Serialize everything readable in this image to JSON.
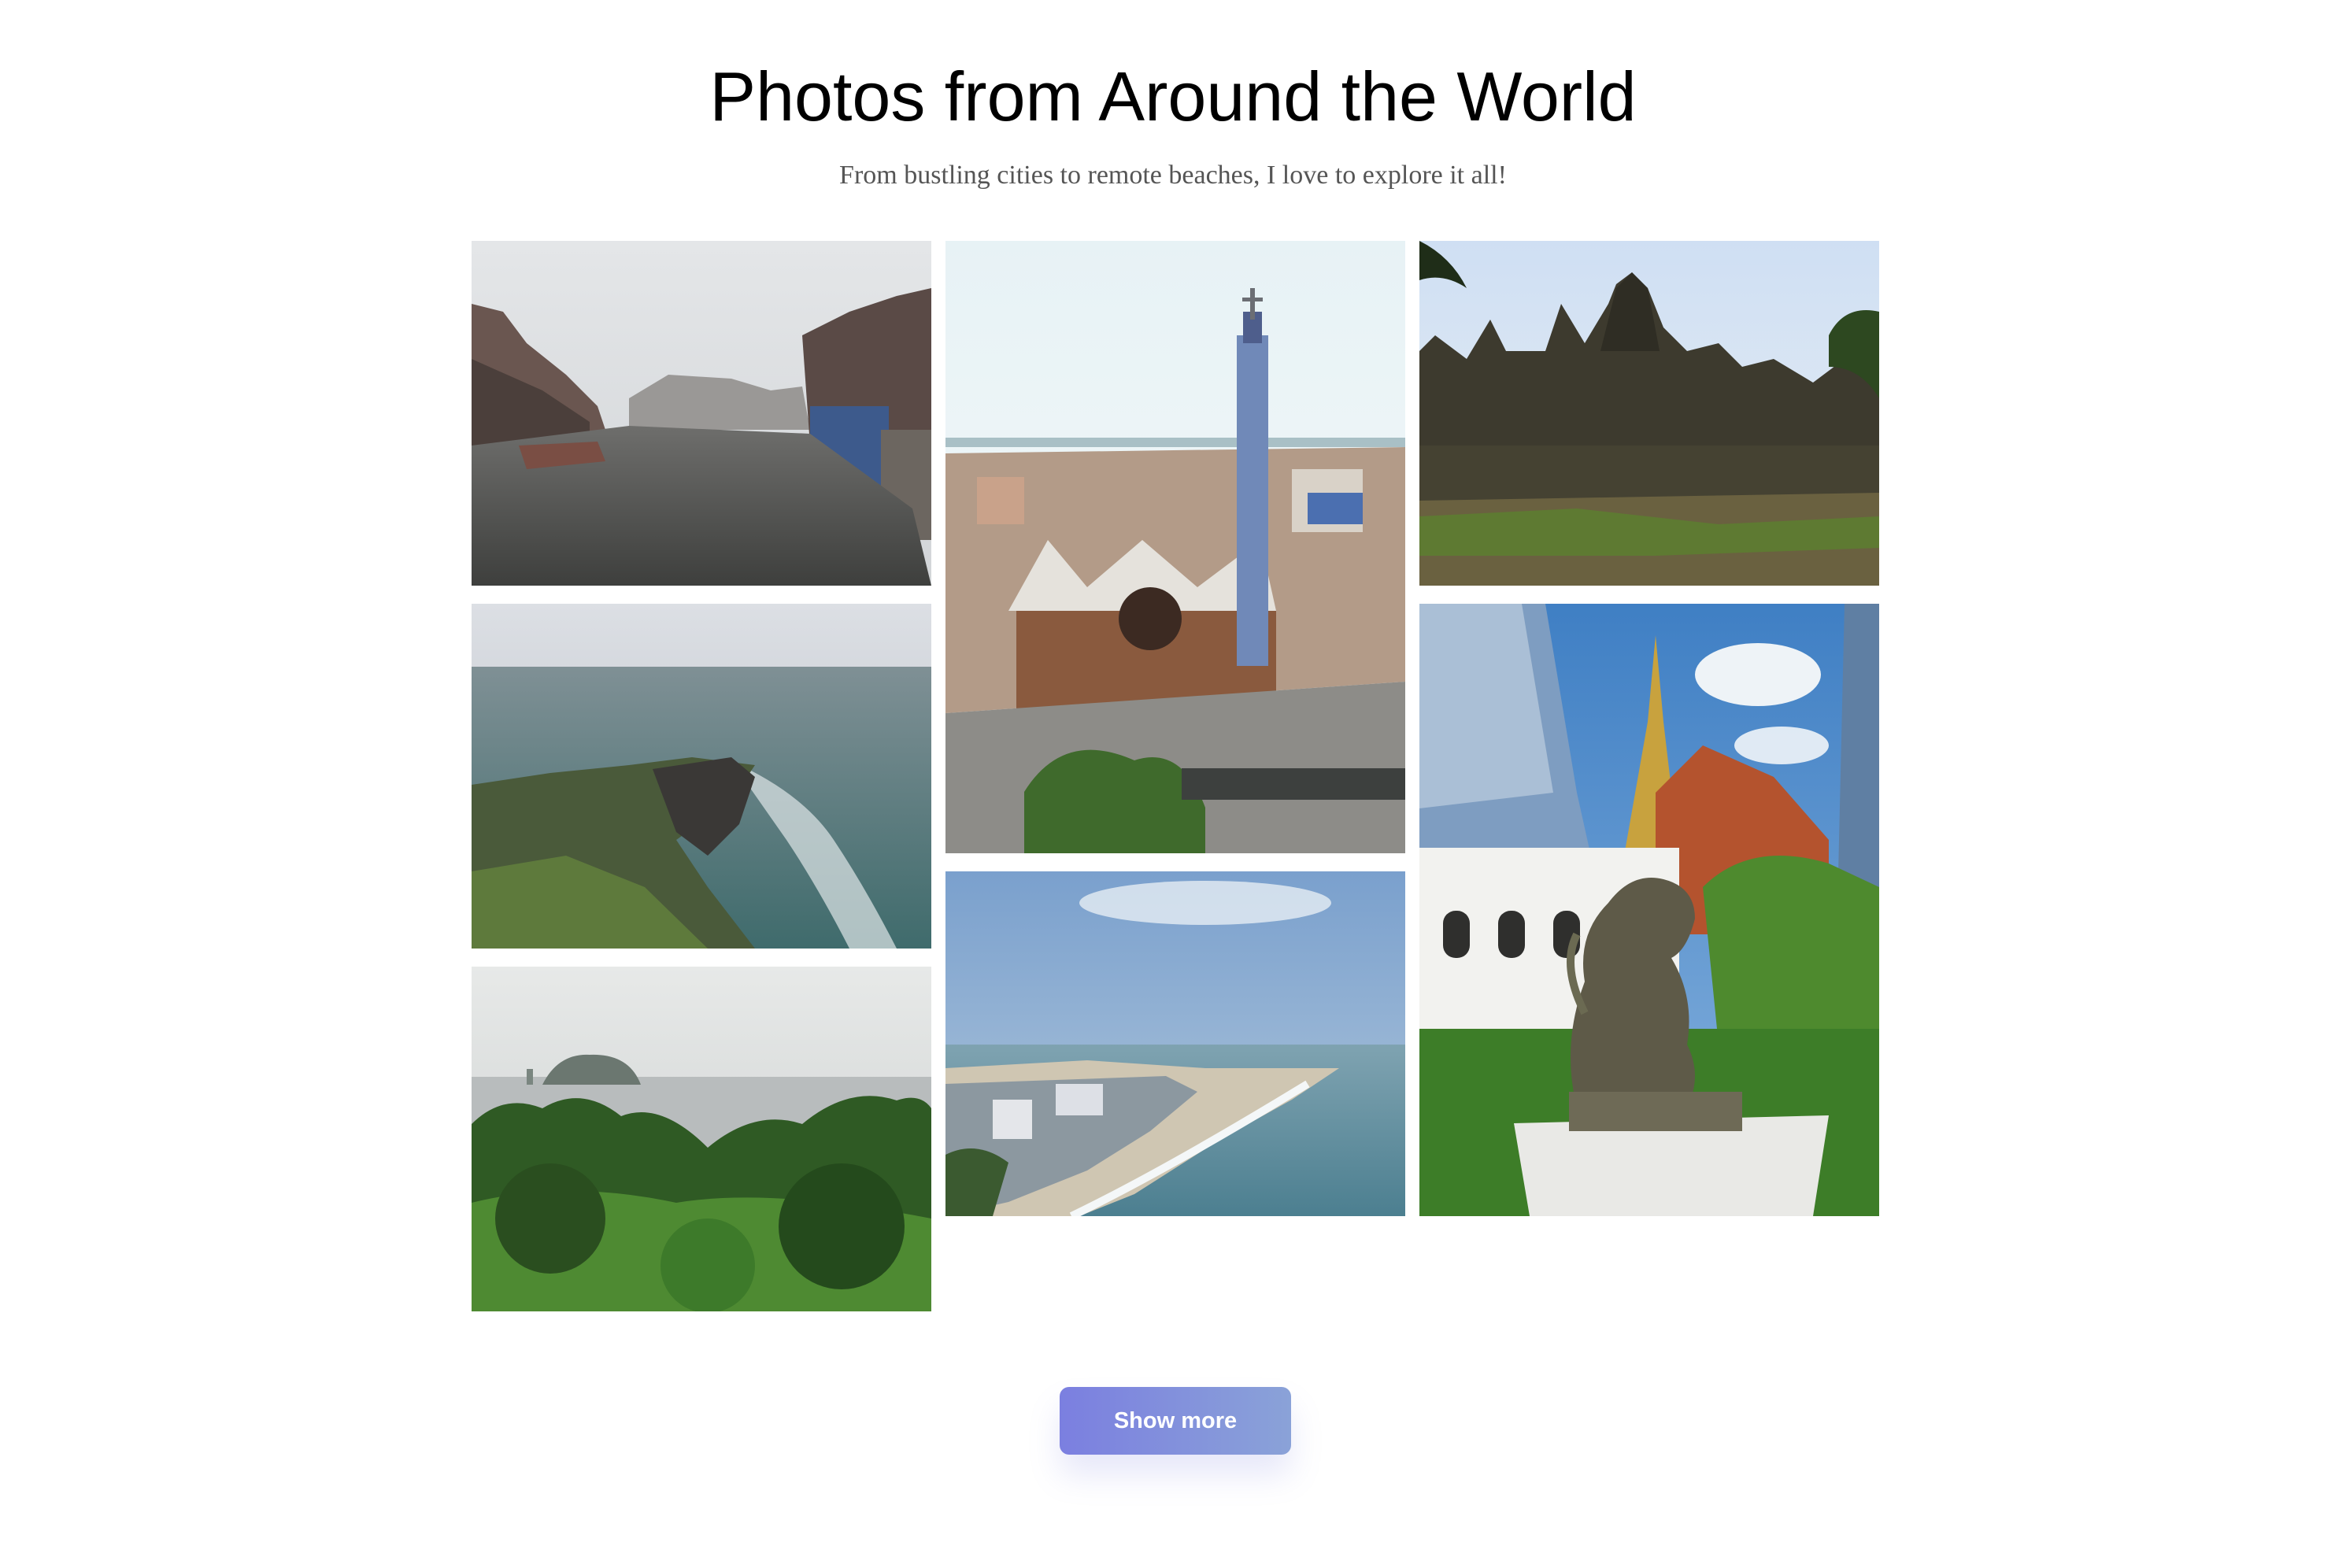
{
  "header": {
    "title": "Photos from Around the World",
    "subtitle": "From bustling cities to remote beaches, I love to explore it all!"
  },
  "gallery": {
    "photos": [
      {
        "name": "canal-city-photo"
      },
      {
        "name": "rocky-coast-photo"
      },
      {
        "name": "island-forest-photo"
      },
      {
        "name": "mosaic-tower-photo"
      },
      {
        "name": "beach-resort-photo"
      },
      {
        "name": "ancient-temple-photo"
      },
      {
        "name": "lion-statue-temple-photo"
      }
    ]
  },
  "actions": {
    "show_more_label": "Show more"
  },
  "colors": {
    "button_gradient_start": "#7b7fe0",
    "button_gradient_end": "#8aa2d8",
    "subtitle_text": "#555555"
  }
}
